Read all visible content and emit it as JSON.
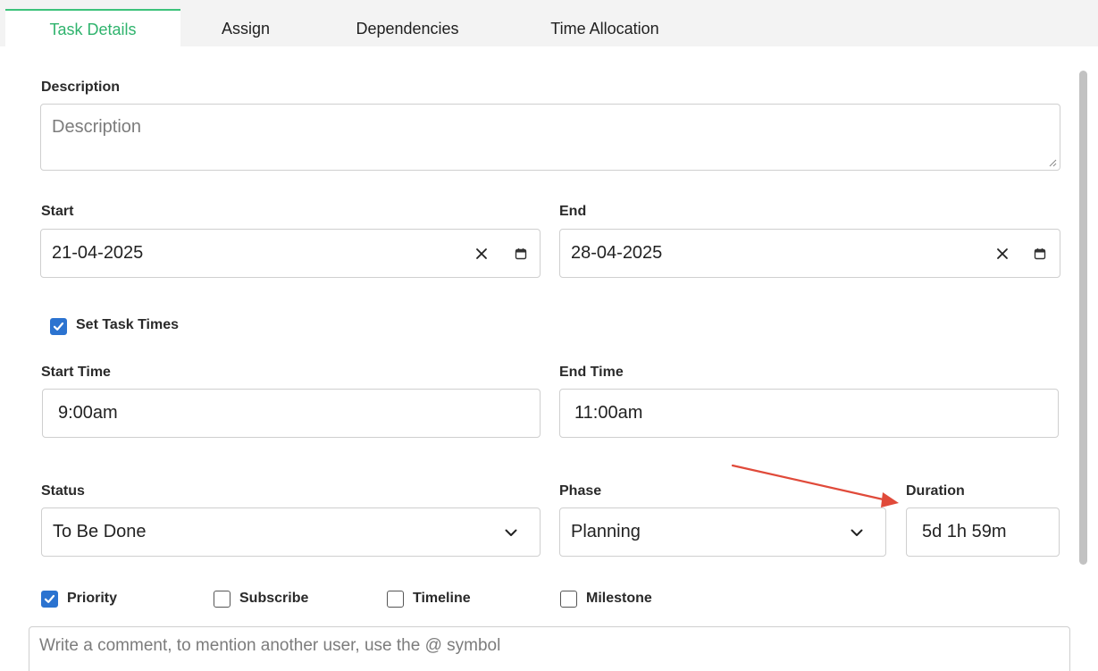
{
  "tabs": [
    {
      "label": "Task Details",
      "active": true
    },
    {
      "label": "Assign",
      "active": false
    },
    {
      "label": "Dependencies",
      "active": false
    },
    {
      "label": "Time Allocation",
      "active": false
    }
  ],
  "description": {
    "label": "Description",
    "placeholder": "Description"
  },
  "start": {
    "label": "Start",
    "value": "21-04-2025"
  },
  "end": {
    "label": "End",
    "value": "28-04-2025"
  },
  "set_task_times": {
    "label": "Set Task Times",
    "checked": true
  },
  "start_time": {
    "label": "Start Time",
    "value": "9:00am"
  },
  "end_time": {
    "label": "End Time",
    "value": "11:00am"
  },
  "status": {
    "label": "Status",
    "value": "To Be Done"
  },
  "phase": {
    "label": "Phase",
    "value": "Planning"
  },
  "duration": {
    "label": "Duration",
    "value": "5d 1h 59m"
  },
  "options": [
    {
      "label": "Priority",
      "checked": true
    },
    {
      "label": "Subscribe",
      "checked": false
    },
    {
      "label": "Timeline",
      "checked": false
    },
    {
      "label": "Milestone",
      "checked": false
    }
  ],
  "comment": {
    "placeholder": "Write a comment, to mention another user, use the @ symbol"
  },
  "icons": {
    "clear": "close-icon",
    "calendar": "calendar-icon",
    "dropdown": "chevron-down-icon",
    "check": "checkmark-icon",
    "annotation": "red-arrow"
  },
  "colors": {
    "active_tab": "#2fb36d",
    "checkbox": "#2b73d0",
    "annotation_arrow": "#e04a3a"
  }
}
